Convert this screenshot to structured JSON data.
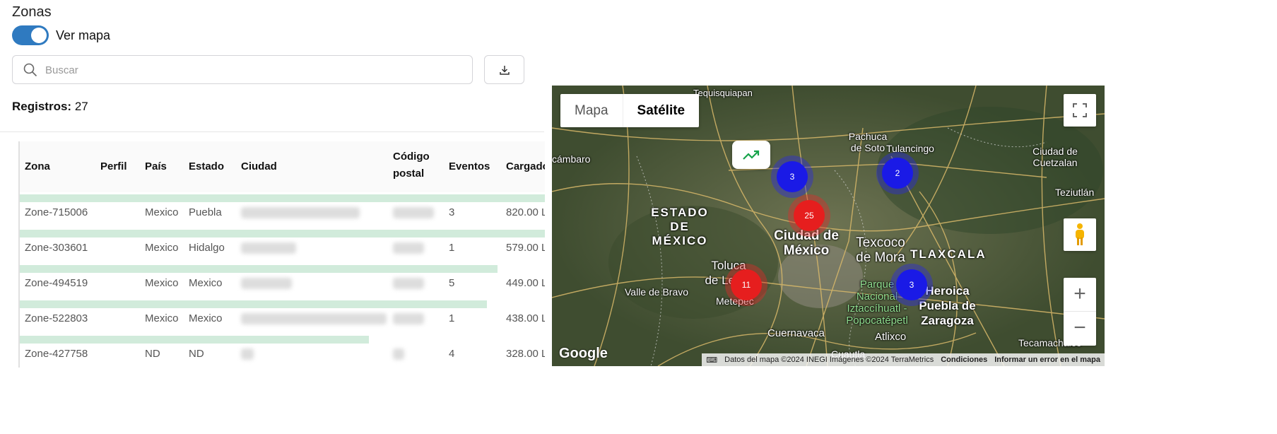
{
  "page": {
    "title": "Zonas",
    "toggle_label": "Ver mapa",
    "toggle_on": true,
    "search_placeholder": "Buscar",
    "search_value": "",
    "records_label": "Registros:",
    "records_count": "27"
  },
  "table": {
    "columns": [
      "Zona",
      "Perfil",
      "País",
      "Estado",
      "Ciudad",
      "Código postal",
      "Eventos",
      "Cargado"
    ],
    "rows": [
      {
        "zona": "Zone-715006",
        "perfil": "",
        "pais": "Mexico",
        "estado": "Puebla",
        "eventos": "3",
        "cargado": "820.00 L",
        "bar_fill": 1.0
      },
      {
        "zona": "Zone-303601",
        "perfil": "",
        "pais": "Mexico",
        "estado": "Hidalgo",
        "eventos": "1",
        "cargado": "579.00 L",
        "bar_fill": 1.0
      },
      {
        "zona": "Zone-494519",
        "perfil": "",
        "pais": "Mexico",
        "estado": "Mexico",
        "eventos": "5",
        "cargado": "449.00 L",
        "bar_fill": 0.89
      },
      {
        "zona": "Zone-522803",
        "perfil": "",
        "pais": "Mexico",
        "estado": "Mexico",
        "eventos": "1",
        "cargado": "438.00 L",
        "bar_fill": 0.87
      },
      {
        "zona": "Zone-427758",
        "perfil": "",
        "pais": "ND",
        "estado": "ND",
        "eventos": "4",
        "cargado": "328.00 L",
        "bar_fill": 0.65
      }
    ]
  },
  "map": {
    "type_buttons": [
      "Mapa",
      "Satélite"
    ],
    "active_type": "Satélite",
    "labels": {
      "toquisquiapan": "Tequisquiapan",
      "pachuca": "Pachuca de Soto",
      "tulancingo": "Tulancingo",
      "cuetzalan": "Ciudad de Cuetzalan",
      "acambaro": "cámbaro",
      "teziutlan": "Teziutlán",
      "edomex": "ESTADO DE MÉXICO",
      "cdmx": "Ciudad de México",
      "texcoco": "Texcoco de Mora",
      "tlaxcala": "TLAXCALA",
      "toluca": "Toluca de Lerdo",
      "valle": "Valle de Bravo",
      "metepec": "Metepec",
      "parque": "Parque Nacional Iztaccíhuatl - Popocatépetl",
      "puebla": "Heroica Puebla de Zaragoza",
      "cuernavaca": "Cuernavaca",
      "atlixco": "Atlixco",
      "tecamachalco": "Tecamachalco",
      "cuautla": "Cuautla"
    },
    "clusters": [
      {
        "count": "3",
        "color": "#1a1ae6"
      },
      {
        "count": "2",
        "color": "#1a1ae6"
      },
      {
        "count": "25",
        "color": "#e61e1e"
      },
      {
        "count": "11",
        "color": "#e61e1e"
      },
      {
        "count": "3",
        "color": "#1a1ae6"
      }
    ],
    "google_logo": "Google",
    "attribution": "Datos del mapa ©2024 INEGI Imágenes ©2024 TerraMetrics",
    "conditions": "Condiciones",
    "report": "Informar un error en el mapa",
    "zoom_in": "+",
    "zoom_out": "−"
  },
  "colors": {
    "accent": "#2f7ac0",
    "bar": "#d1ebdb",
    "trend": "#16a34a"
  }
}
